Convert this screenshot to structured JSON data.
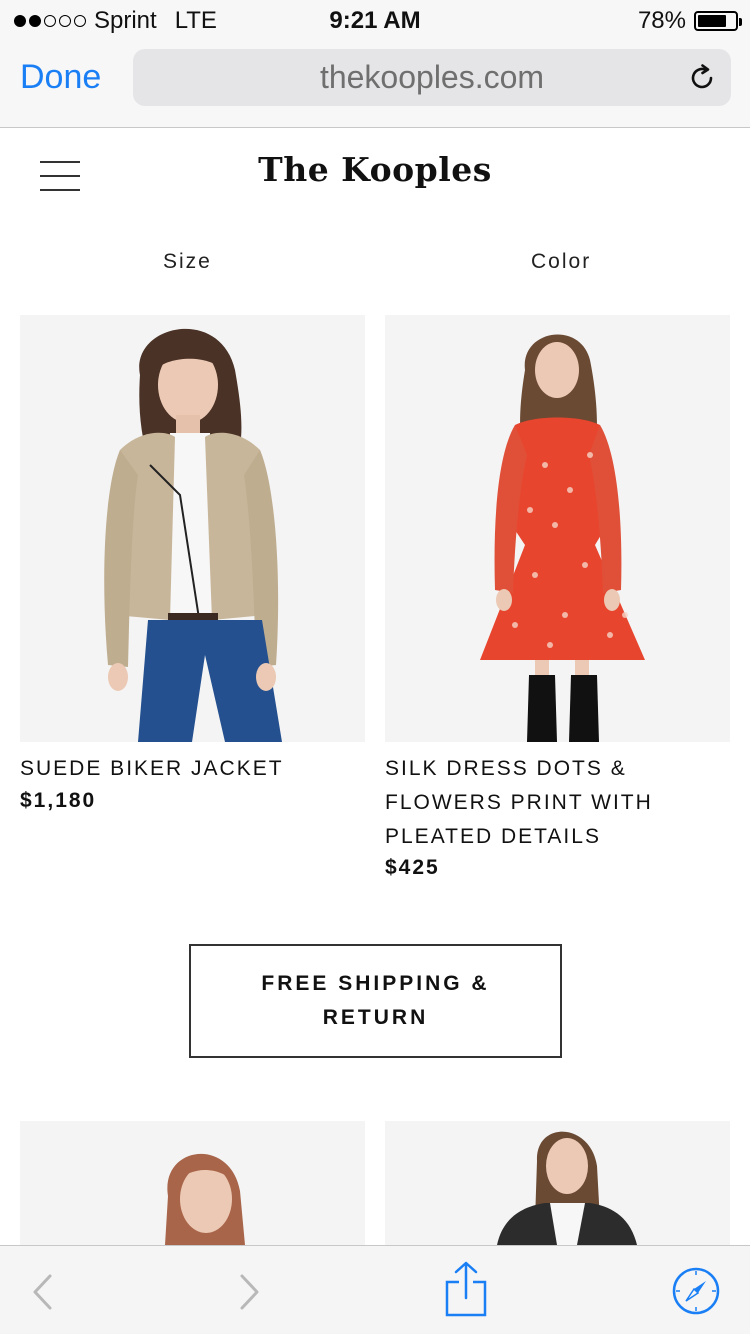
{
  "status_bar": {
    "carrier": "Sprint",
    "network": "LTE",
    "time": "9:21 AM",
    "battery": "78%",
    "battery_level": 0.78
  },
  "browser": {
    "done_label": "Done",
    "url": "thekooples.com"
  },
  "header": {
    "logo_text": "The Kooples"
  },
  "filters": {
    "size_label": "Size",
    "color_label": "Color"
  },
  "products": [
    {
      "name": "SUEDE BIKER JACKET",
      "price": "$1,180"
    },
    {
      "name": "SILK DRESS DOTS & FLOWERS PRINT WITH PLEATED DETAILS",
      "price": "$425"
    }
  ],
  "promo": {
    "label": "FREE SHIPPING & RETURN"
  },
  "colors": {
    "accent_blue": "#1a7ff5",
    "jacket_suede": "#c8b69a",
    "jeans_blue": "#24508f",
    "dress_red": "#e8452e"
  }
}
